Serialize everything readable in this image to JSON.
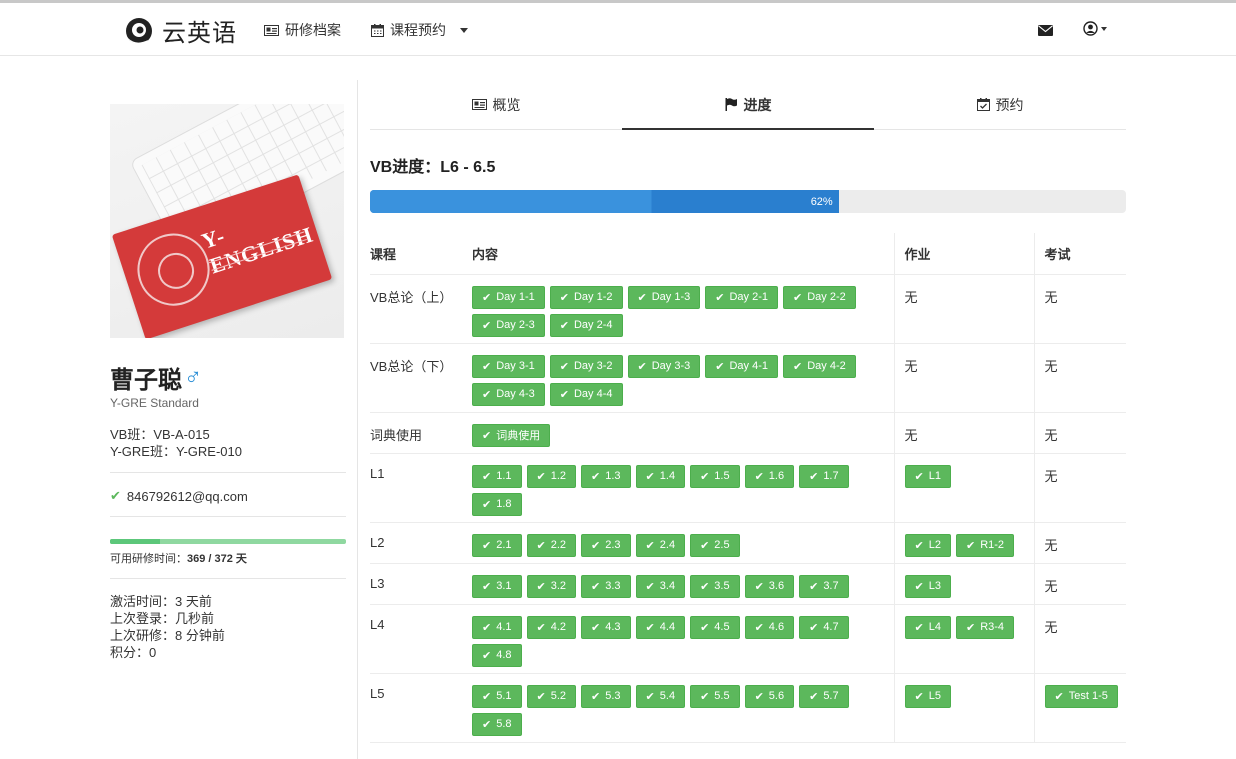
{
  "nav": {
    "brand": "云英语",
    "records_label": "研修档案",
    "booking_label": "课程预约"
  },
  "profile": {
    "name": "曹子聪",
    "gender_symbol": "♂",
    "plan": "Y-GRE Standard",
    "vb_class": "VB班：VB-A-015",
    "ygre_class": "Y-GRE班：Y-GRE-010",
    "email": "846792612@qq.com",
    "study_time_label": "可用研修时间：",
    "study_time_value": "369 / 372 天",
    "study_time_fraction": 0.21,
    "activated": "激活时间：3 天前",
    "last_login": "上次登录：几秒前",
    "last_study": "上次研修：8 分钟前",
    "points": "积分：0",
    "photo_card_text": "Y-ENGLISH"
  },
  "tabs": [
    {
      "label": "概览",
      "icon": "id-card-icon"
    },
    {
      "label": "进度",
      "icon": "flag-icon",
      "active": true
    },
    {
      "label": "预约",
      "icon": "calendar-check-icon"
    }
  ],
  "progress": {
    "title": "VB进度：L6 - 6.5",
    "percent_label": "62%",
    "percent": 62
  },
  "table": {
    "headers": {
      "course": "课程",
      "content": "内容",
      "homework": "作业",
      "exam": "考试"
    },
    "rows": [
      {
        "course": "VB总论（上）",
        "content": [
          "Day 1-1",
          "Day 1-2",
          "Day 1-3",
          "Day 2-1",
          "Day 2-2",
          "Day 2-3",
          "Day 2-4"
        ],
        "homework_text": "无",
        "exam_text": "无"
      },
      {
        "course": "VB总论（下）",
        "content": [
          "Day 3-1",
          "Day 3-2",
          "Day 3-3",
          "Day 4-1",
          "Day 4-2",
          "Day 4-3",
          "Day 4-4"
        ],
        "homework_text": "无",
        "exam_text": "无"
      },
      {
        "course": "词典使用",
        "content": [
          "词典使用"
        ],
        "homework_text": "无",
        "exam_text": "无"
      },
      {
        "course": "L1",
        "content": [
          "1.1",
          "1.2",
          "1.3",
          "1.4",
          "1.5",
          "1.6",
          "1.7",
          "1.8"
        ],
        "homework": [
          "L1"
        ],
        "exam_text": "无"
      },
      {
        "course": "L2",
        "content": [
          "2.1",
          "2.2",
          "2.3",
          "2.4",
          "2.5"
        ],
        "homework": [
          "L2",
          "R1-2"
        ],
        "exam_text": "无"
      },
      {
        "course": "L3",
        "content": [
          "3.1",
          "3.2",
          "3.3",
          "3.4",
          "3.5",
          "3.6",
          "3.7"
        ],
        "homework": [
          "L3"
        ],
        "exam_text": "无"
      },
      {
        "course": "L4",
        "content": [
          "4.1",
          "4.2",
          "4.3",
          "4.4",
          "4.5",
          "4.6",
          "4.7",
          "4.8"
        ],
        "homework": [
          "L4",
          "R3-4"
        ],
        "exam_text": "无"
      },
      {
        "course": "L5",
        "content": [
          "5.1",
          "5.2",
          "5.3",
          "5.4",
          "5.5",
          "5.6",
          "5.7",
          "5.8"
        ],
        "homework": [
          "L5"
        ],
        "exam": [
          "Test 1-5"
        ]
      }
    ]
  },
  "colors": {
    "tag_green": "#5cb85c",
    "progress_blue": "#2c86d6",
    "gender_blue": "#2a8ed6"
  }
}
